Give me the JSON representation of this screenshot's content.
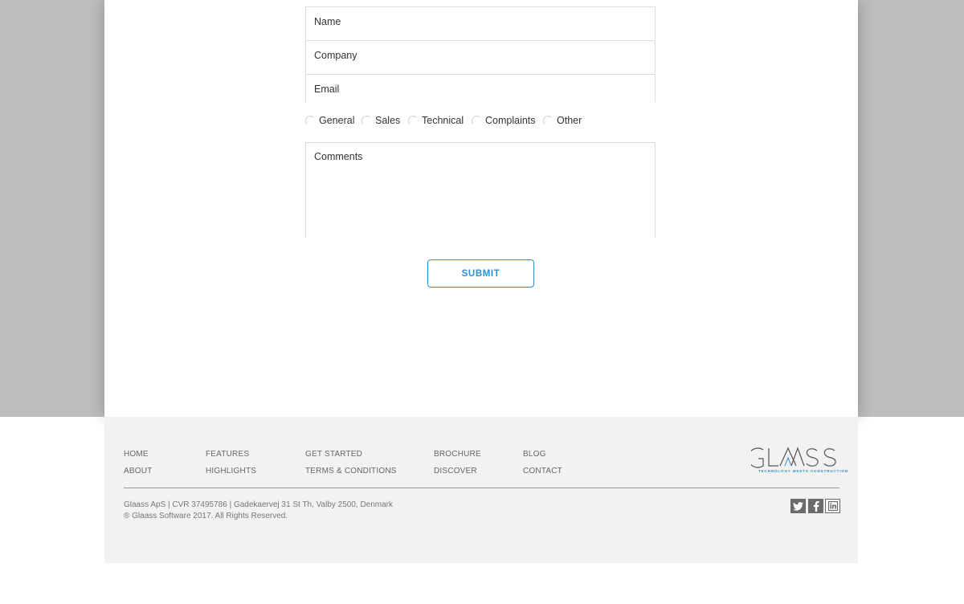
{
  "form": {
    "name_placeholder": "Name",
    "company_placeholder": "Company",
    "email_placeholder": "Email",
    "topics": [
      "General",
      "Sales",
      "Technical",
      "Complaints",
      "Other"
    ],
    "comments_placeholder": "Comments",
    "submit_label": "SUBMIT",
    "accent_color": "#2a8fd0"
  },
  "footer": {
    "nav": {
      "home": "HOME",
      "about": "ABOUT",
      "features": "FEATURES",
      "highlights": "HIGHLIGHTS",
      "get_started": "GET STARTED",
      "terms": "TERMS & CONDITIONS",
      "brochure": "BROCHURE",
      "discover": "DISCOVER",
      "blog": "BLOG",
      "contact": "CONTACT"
    },
    "company_line": "Glaass ApS | CVR 37495786 | Gadekaervej 31 St Th, Valby 2500, Denmark",
    "copyright_line": "® Glaass Software 2017.  All Rights Reserved.",
    "logo": {
      "wordmark": "GLAASS",
      "tagline": "TECHNOLOGY MEETS CONSTRUCTION"
    },
    "social": [
      "twitter-icon",
      "facebook-icon",
      "linkedin-icon"
    ]
  }
}
